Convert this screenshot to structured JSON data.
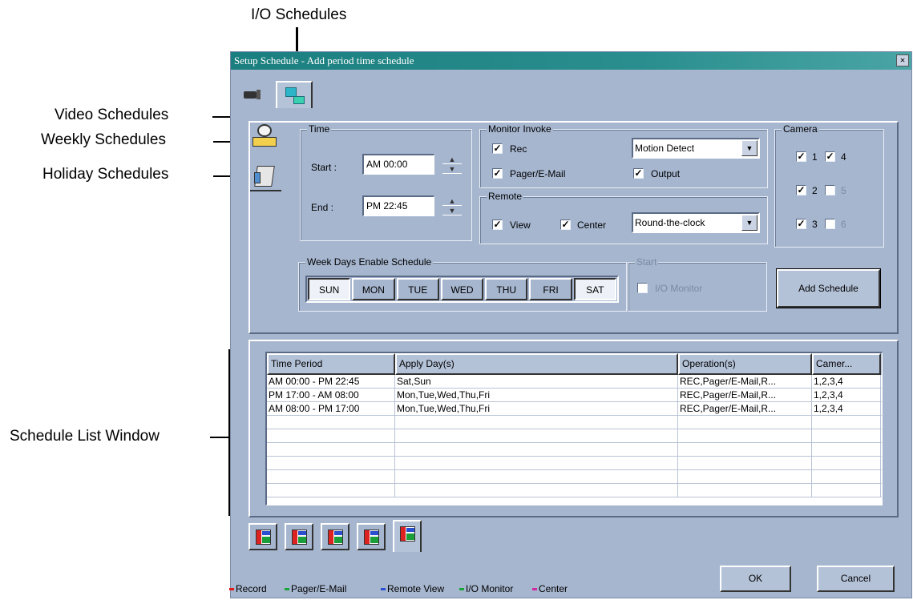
{
  "callouts": {
    "io_schedules": "I/O Schedules",
    "video_schedules": "Video Schedules",
    "weekly_schedules": "Weekly Schedules",
    "holiday_schedules": "Holiday Schedules",
    "schedule_list_window": "Schedule List Window"
  },
  "window": {
    "title": "Setup Schedule - Add period time schedule",
    "close_glyph": "×"
  },
  "time": {
    "group_label": "Time",
    "start_label": "Start :",
    "start_value": "AM 00:00",
    "end_label": "End :",
    "end_value": "PM 22:45"
  },
  "monitor_invoke": {
    "group_label": "Monitor Invoke",
    "rec_label": "Rec",
    "rec_checked": true,
    "pager_label": "Pager/E-Mail",
    "pager_checked": true,
    "mode_value": "Motion Detect",
    "output_label": "Output",
    "output_checked": true
  },
  "remote": {
    "group_label": "Remote",
    "view_label": "View",
    "view_checked": true,
    "center_label": "Center",
    "center_checked": true,
    "mode_value": "Round-the-clock"
  },
  "camera": {
    "group_label": "Camera",
    "items": [
      {
        "label": "1",
        "checked": true,
        "enabled": true
      },
      {
        "label": "4",
        "checked": true,
        "enabled": true
      },
      {
        "label": "2",
        "checked": true,
        "enabled": true
      },
      {
        "label": "5",
        "checked": false,
        "enabled": false
      },
      {
        "label": "3",
        "checked": true,
        "enabled": true
      },
      {
        "label": "6",
        "checked": false,
        "enabled": false
      }
    ]
  },
  "weekdays": {
    "group_label": "Week Days Enable Schedule",
    "days": [
      {
        "label": "SUN",
        "selected": true
      },
      {
        "label": "MON",
        "selected": false
      },
      {
        "label": "TUE",
        "selected": false
      },
      {
        "label": "WED",
        "selected": false
      },
      {
        "label": "THU",
        "selected": false
      },
      {
        "label": "FRI",
        "selected": false
      },
      {
        "label": "SAT",
        "selected": true
      }
    ]
  },
  "start_group": {
    "group_label": "Start",
    "io_monitor_label": "I/O Monitor",
    "io_monitor_checked": false
  },
  "buttons": {
    "add_schedule": "Add Schedule",
    "ok": "OK",
    "cancel": "Cancel"
  },
  "table": {
    "columns": [
      "Time Period",
      "Apply Day(s)",
      "Operation(s)",
      "Camer..."
    ],
    "rows": [
      [
        "AM 00:00 - PM 22:45",
        "Sat,Sun",
        "REC,Pager/E-Mail,R...",
        "1,2,3,4"
      ],
      [
        "PM 17:00 - AM 08:00",
        "Mon,Tue,Wed,Thu,Fri",
        "REC,Pager/E-Mail,R...",
        "1,2,3,4"
      ],
      [
        "AM 08:00 - PM 17:00",
        "Mon,Tue,Wed,Thu,Fri",
        "REC,Pager/E-Mail,R...",
        "1,2,3,4"
      ],
      [
        "",
        "",
        "",
        ""
      ],
      [
        "",
        "",
        "",
        ""
      ],
      [
        "",
        "",
        "",
        ""
      ],
      [
        "",
        "",
        "",
        ""
      ],
      [
        "",
        "",
        "",
        ""
      ],
      [
        "",
        "",
        "",
        ""
      ]
    ]
  },
  "schedule_tabs": [
    {
      "name": "schedule-tab-1-icon",
      "selected": false
    },
    {
      "name": "schedule-tab-2-icon",
      "selected": false
    },
    {
      "name": "schedule-tab-3-icon",
      "selected": false
    },
    {
      "name": "schedule-tab-4-icon",
      "selected": false
    },
    {
      "name": "schedule-tab-5-icon",
      "selected": true
    }
  ],
  "legend": {
    "record": "Record",
    "pager": "Pager/E-Mail",
    "remote_view": "Remote View",
    "io_monitor": "I/O Monitor",
    "center": "Center",
    "colors": {
      "record": "#e01a1a",
      "pager": "#1aa53a",
      "remote_view": "#2a4fd0",
      "io_monitor": "#1aa53a",
      "center": "#d02aa0"
    }
  },
  "colors": {
    "window_bg": "#a6b6cf",
    "titlebar": "#1b7f7f"
  }
}
